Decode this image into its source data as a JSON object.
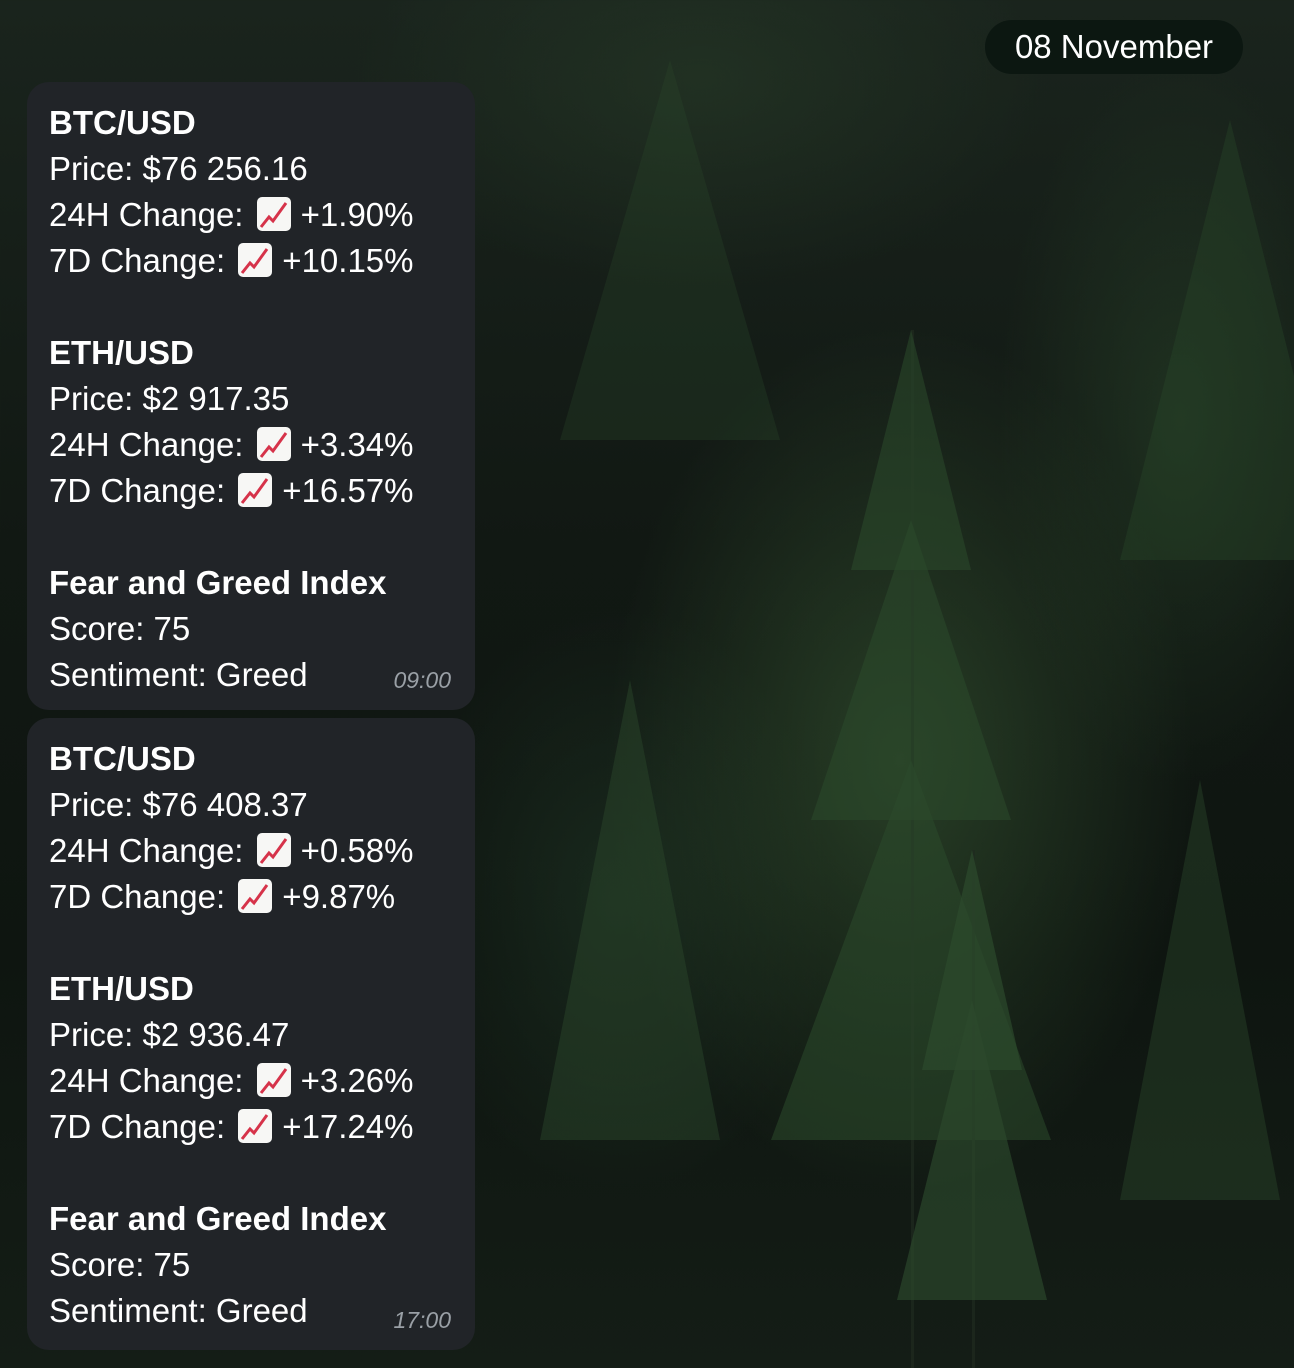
{
  "date_label": "08 November",
  "messages": [
    {
      "time": "09:00",
      "btc": {
        "title": "BTC/USD",
        "price": "Price: $76 256.16",
        "h24_label": "24H Change:",
        "h24_value": "+1.90%",
        "d7_label": "7D Change:",
        "d7_value": "+10.15%"
      },
      "eth": {
        "title": "ETH/USD",
        "price": "Price: $2 917.35",
        "h24_label": "24H Change:",
        "h24_value": "+3.34%",
        "d7_label": "7D Change:",
        "d7_value": "+16.57%"
      },
      "fng": {
        "title": "Fear and Greed Index",
        "score": "Score: 75",
        "sentiment": "Sentiment: Greed"
      }
    },
    {
      "time": "17:00",
      "btc": {
        "title": "BTC/USD",
        "price": "Price: $76 408.37",
        "h24_label": "24H Change:",
        "h24_value": "+0.58%",
        "d7_label": "7D Change:",
        "d7_value": "+9.87%"
      },
      "eth": {
        "title": "ETH/USD",
        "price": "Price: $2 936.47",
        "h24_label": "24H Change:",
        "h24_value": "+3.26%",
        "d7_label": "7D Change:",
        "d7_value": "+17.24%"
      },
      "fng": {
        "title": "Fear and Greed Index",
        "score": "Score: 75",
        "sentiment": "Sentiment: Greed"
      }
    }
  ],
  "icons": {
    "trend": "chart-increasing-icon"
  },
  "colors": {
    "bubble_bg": "#212428",
    "time_text": "#9aa0a6",
    "date_pill_bg": "#0a1610"
  }
}
